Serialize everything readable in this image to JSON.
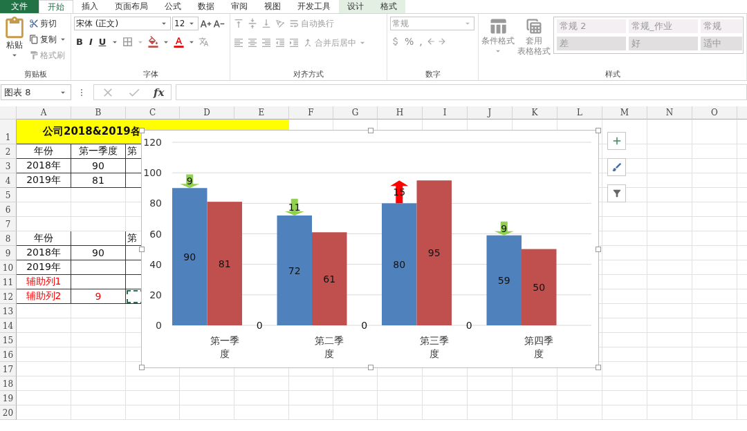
{
  "ribbon_tabs": [
    {
      "label": "文件",
      "kind": "file",
      "selected": false
    },
    {
      "label": "开始",
      "kind": "normal",
      "selected": true
    },
    {
      "label": "插入",
      "kind": "normal",
      "selected": false
    },
    {
      "label": "页面布局",
      "kind": "normal",
      "selected": false
    },
    {
      "label": "公式",
      "kind": "normal",
      "selected": false
    },
    {
      "label": "数据",
      "kind": "normal",
      "selected": false
    },
    {
      "label": "审阅",
      "kind": "normal",
      "selected": false
    },
    {
      "label": "视图",
      "kind": "normal",
      "selected": false
    },
    {
      "label": "开发工具",
      "kind": "normal",
      "selected": false
    },
    {
      "label": "设计",
      "kind": "context",
      "selected": false
    },
    {
      "label": "格式",
      "kind": "context",
      "selected": false
    }
  ],
  "clipboard": {
    "paste": "粘贴",
    "cut": "剪切",
    "copy": "复制",
    "format_painter": "格式刷",
    "label": "剪贴板"
  },
  "font": {
    "name": "宋体 (正文)",
    "size": "12",
    "bold": "B",
    "italic": "I",
    "underline": "U",
    "label": "字体"
  },
  "alignment": {
    "wrap": "自动换行",
    "merge": "合并后居中",
    "label": "对齐方式"
  },
  "number": {
    "format": "常规",
    "percent": "%",
    "comma": ",",
    "label": "数字"
  },
  "styles": {
    "conditional": "条件格式",
    "table_format_1": "套用",
    "table_format_2": "表格格式",
    "label": "样式",
    "cells": [
      {
        "label": "常规 2",
        "kind": "light"
      },
      {
        "label": "常规_作业",
        "kind": "light"
      },
      {
        "label": "常规",
        "kind": "light"
      },
      {
        "label": "差",
        "kind": "dark"
      },
      {
        "label": "好",
        "kind": "dark"
      },
      {
        "label": "适中",
        "kind": "dark"
      }
    ]
  },
  "formula_bar": {
    "name_box": "图表 8",
    "fx": "fx"
  },
  "sheet": {
    "columns": [
      "A",
      "B",
      "C",
      "D",
      "E",
      "F",
      "G",
      "H",
      "I",
      "J",
      "K",
      "L",
      "M",
      "N",
      "O"
    ],
    "rows": [
      {
        "number": "1",
        "kind": "title",
        "cells": {
          "A": "公司2018&2019各"
        }
      },
      {
        "number": "2",
        "kind": "table",
        "cells": {
          "A": "年份",
          "B": "第一季度",
          "C": "第"
        }
      },
      {
        "number": "3",
        "kind": "table",
        "cells": {
          "A": "2018年",
          "B": "90"
        }
      },
      {
        "number": "4",
        "kind": "table",
        "cells": {
          "A": "2019年",
          "B": "81"
        }
      },
      {
        "number": "5",
        "kind": "blank",
        "cells": {}
      },
      {
        "number": "6",
        "kind": "blank",
        "cells": {}
      },
      {
        "number": "7",
        "kind": "blank",
        "cells": {}
      },
      {
        "number": "8",
        "kind": "table",
        "cells": {
          "A": "年份",
          "C": "第"
        }
      },
      {
        "number": "9",
        "kind": "table",
        "cells": {
          "A": "2018年",
          "B": "90"
        }
      },
      {
        "number": "10",
        "kind": "table",
        "cells": {
          "A": "2019年"
        }
      },
      {
        "number": "11",
        "kind": "helper",
        "cells": {
          "A": "辅助列1"
        }
      },
      {
        "number": "12",
        "kind": "helper",
        "copied": true,
        "cells": {
          "A": "辅助列2",
          "B": "9"
        }
      },
      {
        "number": "13",
        "kind": "blank",
        "cells": {}
      },
      {
        "number": "14",
        "kind": "blank",
        "cells": {}
      },
      {
        "number": "15",
        "kind": "blank",
        "cells": {}
      },
      {
        "number": "16",
        "kind": "blank",
        "cells": {}
      },
      {
        "number": "17",
        "kind": "blank",
        "cells": {}
      },
      {
        "number": "18",
        "kind": "blank",
        "cells": {}
      },
      {
        "number": "19",
        "kind": "blank",
        "cells": {}
      },
      {
        "number": "20",
        "kind": "blank",
        "cells": {}
      }
    ],
    "chart": {
      "chart_data": {
        "type": "bar",
        "categories": [
          "第一季度",
          "第二季度",
          "第三季度",
          "第四季度"
        ],
        "series": [
          {
            "color": "#4f81bd",
            "values": [
              90,
              72,
              80,
              59
            ]
          },
          {
            "color": "#c0504d",
            "values": [
              81,
              61,
              95,
              50
            ]
          },
          {
            "values": [
              0,
              0,
              0,
              null
            ]
          }
        ],
        "ylim": [
          0,
          120
        ],
        "grid": true,
        "yticks": [
          {
            "value": 0,
            "label": "0"
          },
          {
            "value": 20,
            "label": "20"
          },
          {
            "value": 40,
            "label": "40"
          },
          {
            "value": 60,
            "label": "60"
          },
          {
            "value": 80,
            "label": "80"
          },
          {
            "value": 100,
            "label": "100"
          },
          {
            "value": 120,
            "label": "120"
          }
        ],
        "value_labels": [
          [
            "90",
            "72",
            "80",
            "59"
          ],
          [
            "81",
            "61",
            "95",
            "50"
          ],
          [
            "0",
            "0",
            "0",
            null
          ]
        ],
        "annotations": [
          "9",
          "11",
          "15",
          "9"
        ]
      }
    }
  }
}
